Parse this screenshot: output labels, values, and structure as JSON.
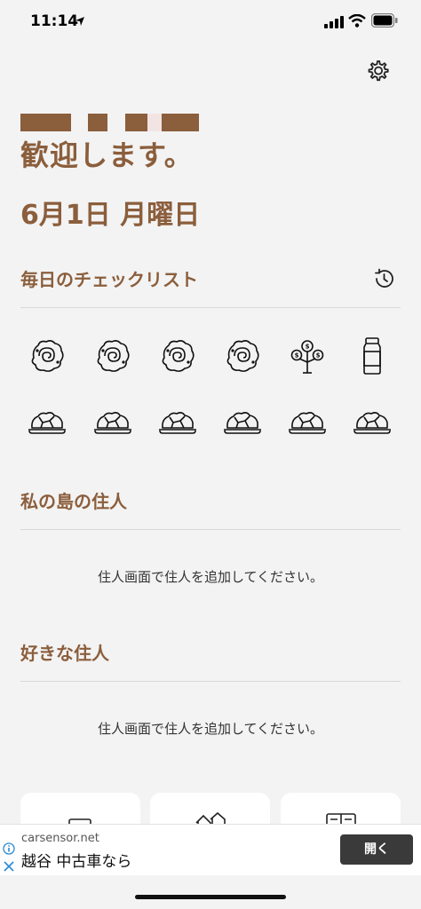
{
  "status_bar": {
    "time": "11:14",
    "icons": [
      "location-arrow-icon",
      "signal-bars-icon",
      "wifi-icon",
      "battery-icon"
    ]
  },
  "header": {
    "settings_icon": "gear-icon",
    "welcome": "歓迎します。",
    "date": "6月1日 月曜日"
  },
  "checklist": {
    "title": "毎日のチェックリスト",
    "history_icon": "history-icon",
    "row1": [
      "fossil-icon",
      "fossil-icon",
      "fossil-icon",
      "fossil-icon",
      "money-tree-icon",
      "bottle-icon"
    ],
    "row2": [
      "rock-icon",
      "rock-icon",
      "rock-icon",
      "rock-icon",
      "rock-icon",
      "rock-icon"
    ]
  },
  "island_residents": {
    "title": "私の島の住人",
    "empty_message": "住人画面で住人を追加してください。"
  },
  "favorite_residents": {
    "title": "好きな住人",
    "empty_message": "住人画面で住人を追加してください。"
  },
  "ad": {
    "domain": "carsensor.net",
    "text": "越谷 中古車なら",
    "button": "開く"
  },
  "colors": {
    "accent": "#8b5e3c",
    "background": "#f3f3f3",
    "ad_button": "#3a3a3a"
  }
}
